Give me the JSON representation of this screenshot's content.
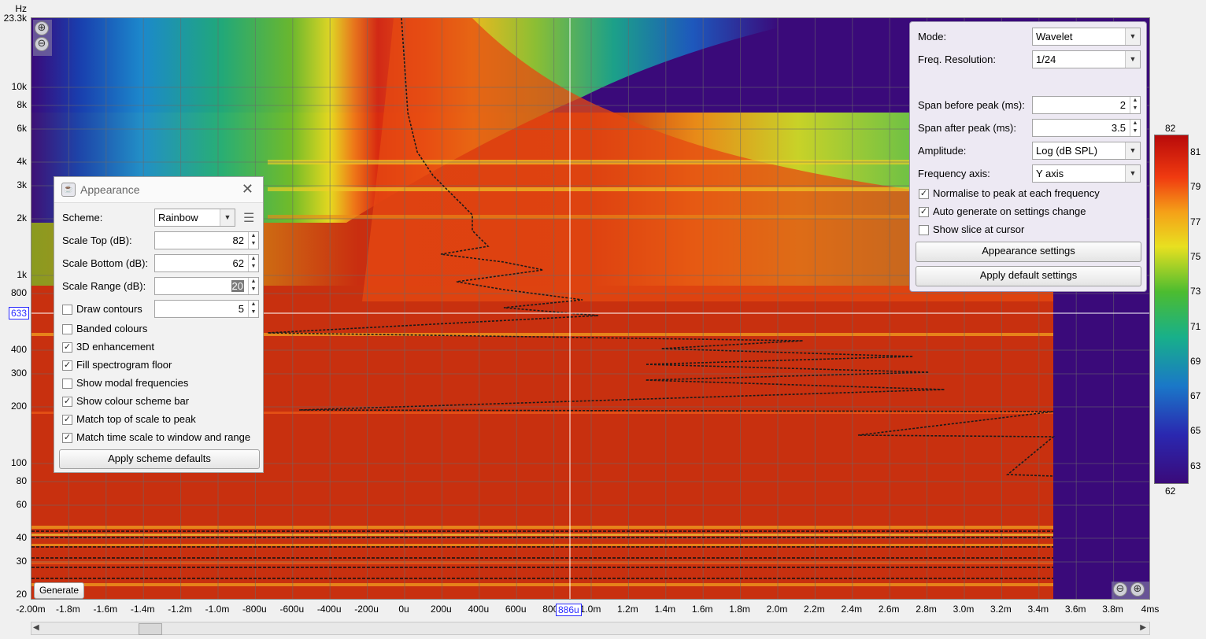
{
  "axis": {
    "y_unit": "Hz",
    "y_labels": [
      "23.3k",
      "10k",
      "8k",
      "6k",
      "4k",
      "3k",
      "2k",
      "1k",
      "800",
      "400",
      "300",
      "200",
      "100",
      "80",
      "60",
      "40",
      "30",
      "20"
    ],
    "x_labels": [
      "-2.00m",
      "-1.8m",
      "-1.6m",
      "-1.4m",
      "-1.2m",
      "-1.0m",
      "-800u",
      "-600u",
      "-400u",
      "-200u",
      "0u",
      "200u",
      "400u",
      "600u",
      "800u",
      "1.0m",
      "1.2m",
      "1.4m",
      "1.6m",
      "1.8m",
      "2.0m",
      "2.2m",
      "2.4m",
      "2.6m",
      "2.8m",
      "3.0m",
      "3.2m",
      "3.4m",
      "3.6m",
      "3.8m",
      "4ms"
    ],
    "cursor_freq": "633",
    "cursor_time": "886u"
  },
  "zoom": {
    "in_icon": "⊕",
    "out_icon": "⊖"
  },
  "generate_label": "Generate",
  "appearance": {
    "title": "Appearance",
    "scheme_label": "Scheme:",
    "scheme_value": "Rainbow",
    "scale_top_label": "Scale Top (dB):",
    "scale_top_value": "82",
    "scale_bottom_label": "Scale Bottom (dB):",
    "scale_bottom_value": "62",
    "scale_range_label": "Scale Range (dB):",
    "scale_range_value": "20",
    "draw_contours_label": "Draw contours",
    "draw_contours_value": "5",
    "checks": [
      {
        "label": "Banded colours",
        "checked": false
      },
      {
        "label": "3D enhancement",
        "checked": true
      },
      {
        "label": "Fill spectrogram floor",
        "checked": true
      },
      {
        "label": "Show modal frequencies",
        "checked": false
      },
      {
        "label": "Show colour scheme bar",
        "checked": true
      },
      {
        "label": "Match top of scale to peak",
        "checked": true
      },
      {
        "label": "Match time scale to window and range",
        "checked": true
      }
    ],
    "apply_defaults": "Apply scheme defaults"
  },
  "settings": {
    "mode_label": "Mode:",
    "mode_value": "Wavelet",
    "freq_res_label": "Freq. Resolution:",
    "freq_res_value": "1/24",
    "span_before_label": "Span before peak (ms):",
    "span_before_value": "2",
    "span_after_label": "Span after peak (ms):",
    "span_after_value": "3.5",
    "amplitude_label": "Amplitude:",
    "amplitude_value": "Log (dB SPL)",
    "freq_axis_label": "Frequency axis:",
    "freq_axis_value": "Y axis",
    "checks": [
      {
        "label": "Normalise to peak at each frequency",
        "checked": true
      },
      {
        "label": "Auto generate on settings change",
        "checked": true
      },
      {
        "label": "Show slice at cursor",
        "checked": false
      }
    ],
    "appearance_btn": "Appearance settings",
    "apply_default_btn": "Apply default settings"
  },
  "scale": {
    "top": "82",
    "bottom": "62",
    "labels": [
      "81",
      "79",
      "77",
      "75",
      "73",
      "71",
      "69",
      "67",
      "65",
      "63"
    ]
  }
}
